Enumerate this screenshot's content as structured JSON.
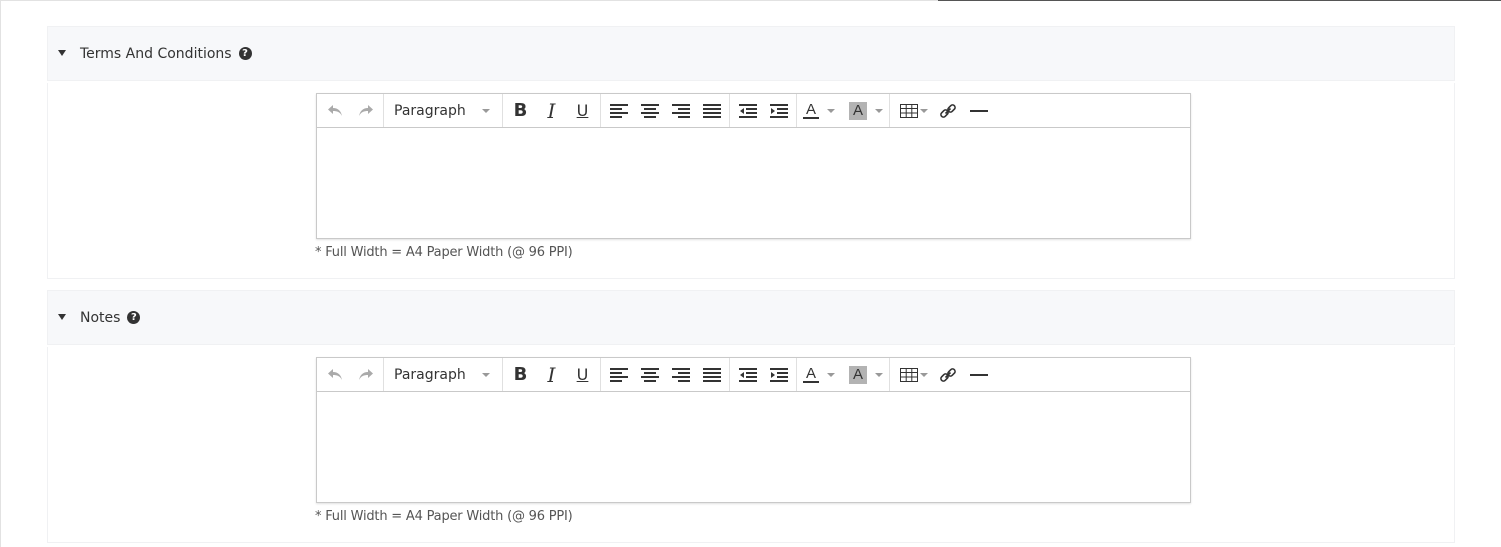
{
  "sections": [
    {
      "title": "Terms And Conditions",
      "help_icon": "question-circle-icon",
      "editor": {
        "format_label": "Paragraph",
        "footnote": "* Full Width = A4 Paper Width (@ 96 PPI)"
      }
    },
    {
      "title": "Notes",
      "help_icon": "question-circle-icon",
      "editor": {
        "format_label": "Paragraph",
        "footnote": "* Full Width = A4 Paper Width (@ 96 PPI)"
      }
    }
  ],
  "toolbar": {
    "bold_glyph": "B",
    "italic_glyph": "I",
    "underline_glyph": "U",
    "text_color_glyph": "A",
    "bg_color_glyph": "A",
    "help_glyph": "?"
  },
  "colors": {
    "header_bg": "#f7f8fa",
    "icon": "#333333",
    "icon_disabled": "#aaaaaa",
    "highlight_swatch": "#b3b3b3"
  }
}
